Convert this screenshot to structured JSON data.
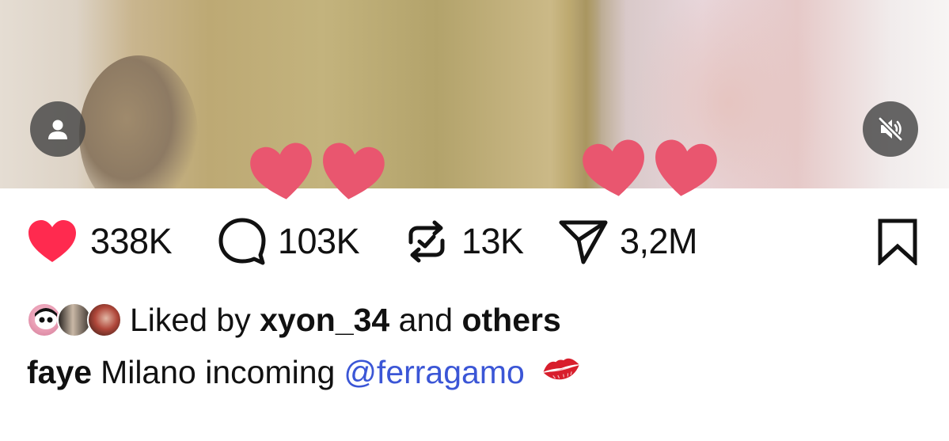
{
  "post": {
    "media": {
      "profile_icon": "user-icon",
      "mute_icon": "speaker-muted-icon"
    },
    "actions": {
      "likes": {
        "icon": "heart-filled-icon",
        "count": "338K",
        "color": "#ff2a4f"
      },
      "comments": {
        "icon": "comment-bubble-icon",
        "count": "103K"
      },
      "reposts": {
        "icon": "repost-icon",
        "count": "13K"
      },
      "shares": {
        "icon": "send-icon",
        "count": "3,2M"
      },
      "save": {
        "icon": "bookmark-icon"
      }
    },
    "liked_by": {
      "prefix": "Liked by",
      "user": "xyon_34",
      "conjunction": "and",
      "others": "others"
    },
    "caption": {
      "username": "faye",
      "text": "Milano incoming",
      "mention": "@ferragamo",
      "mention_color": "#3b56d6",
      "emoji": "kiss-mark-icon"
    },
    "floating_hearts_color": "#e9566f"
  }
}
